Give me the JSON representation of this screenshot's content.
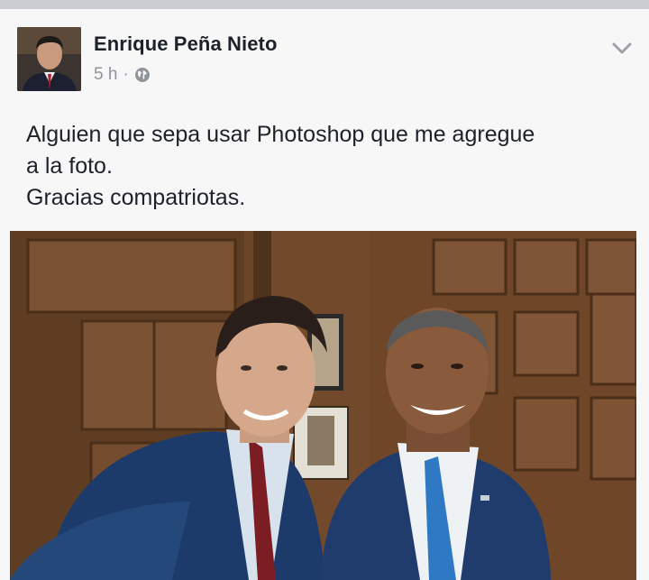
{
  "post": {
    "author": "Enrique Peña Nieto",
    "timestamp": "5 h",
    "separator": "·",
    "privacy_icon": "globe-icon",
    "text_lines": [
      "Alguien que sepa usar Photoshop que me agregue",
      "a la foto.",
      "Gracias compatriotas."
    ],
    "options_icon": "chevron-down-icon"
  },
  "colors": {
    "author": "#1d2129",
    "meta": "#90949c",
    "background": "#f7f7f7",
    "wood": "#6b4527"
  }
}
